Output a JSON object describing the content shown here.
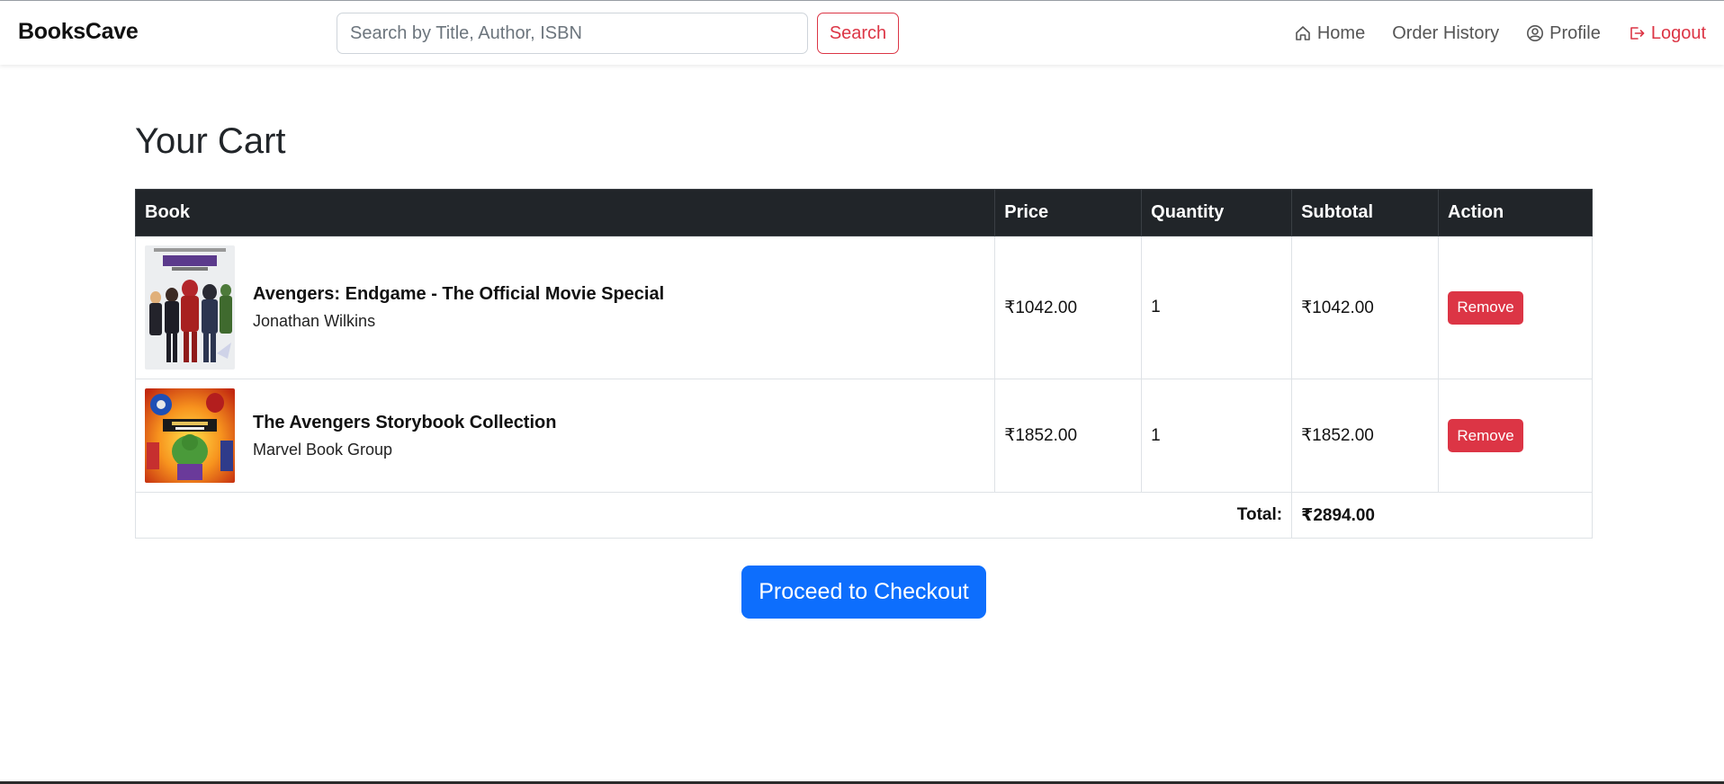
{
  "navbar": {
    "brand": "BooksCave",
    "search_placeholder": "Search by Title, Author, ISBN",
    "search_button": "Search",
    "links": {
      "home": "Home",
      "order_history": "Order History",
      "profile": "Profile",
      "logout": "Logout"
    },
    "accent_color": "#dc3545"
  },
  "page": {
    "title": "Your Cart"
  },
  "table": {
    "headers": {
      "book": "Book",
      "price": "Price",
      "quantity": "Quantity",
      "subtotal": "Subtotal",
      "action": "Action"
    },
    "rows": [
      {
        "title": "Avengers: Endgame - The Official Movie Special",
        "author": "Jonathan Wilkins",
        "price": "₹1042.00",
        "quantity": "1",
        "subtotal": "₹1042.00",
        "action": "Remove"
      },
      {
        "title": "The Avengers Storybook Collection",
        "author": "Marvel Book Group",
        "price": "₹1852.00",
        "quantity": "1",
        "subtotal": "₹1852.00",
        "action": "Remove"
      }
    ],
    "total_label": "Total:",
    "total_value": "₹2894.00"
  },
  "checkout": {
    "label": "Proceed to Checkout",
    "color": "#0d6efd"
  },
  "icons": {
    "home": "house-icon",
    "profile": "user-circle-icon",
    "logout": "logout-icon"
  }
}
